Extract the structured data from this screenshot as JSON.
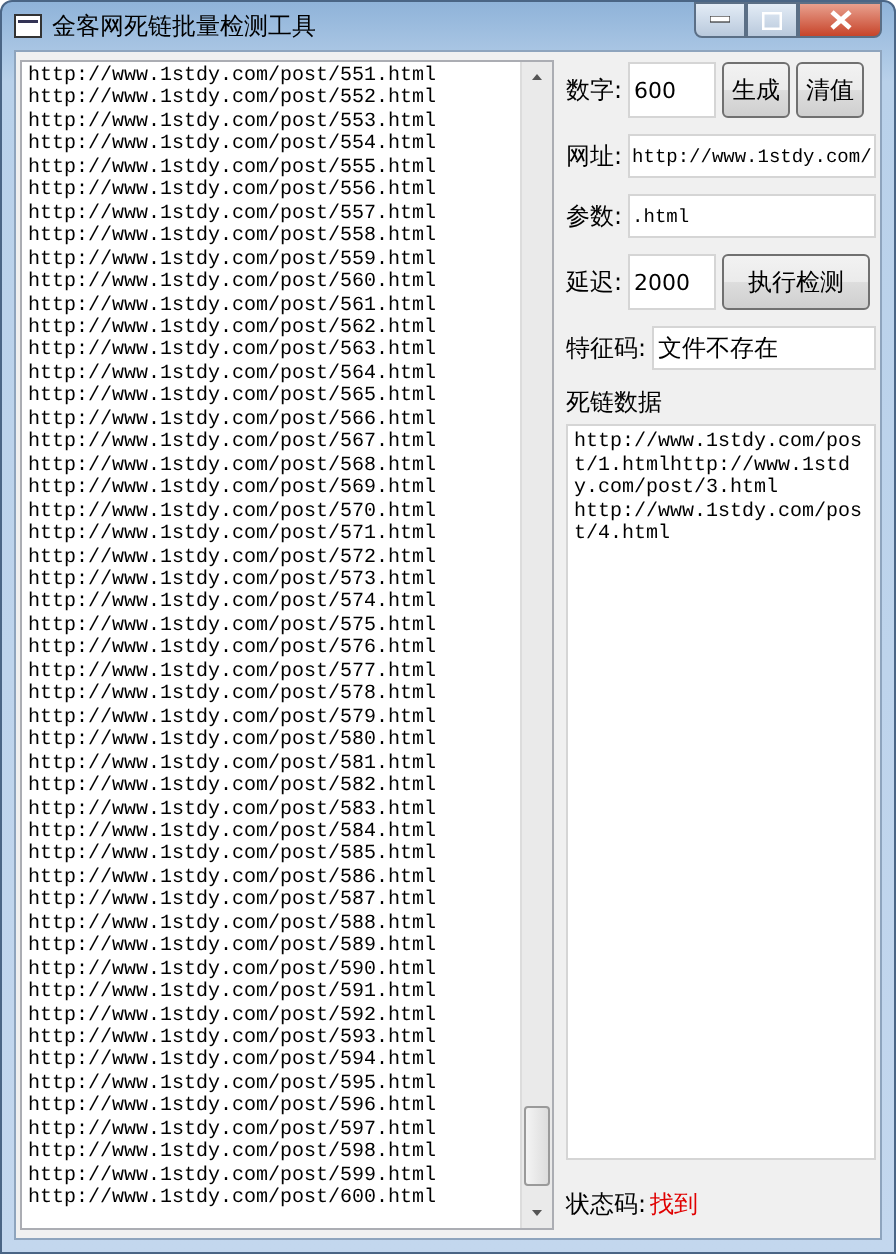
{
  "window": {
    "title": "金客网死链批量检测工具"
  },
  "url_list": [
    "http://www.1stdy.com/post/551.html",
    "http://www.1stdy.com/post/552.html",
    "http://www.1stdy.com/post/553.html",
    "http://www.1stdy.com/post/554.html",
    "http://www.1stdy.com/post/555.html",
    "http://www.1stdy.com/post/556.html",
    "http://www.1stdy.com/post/557.html",
    "http://www.1stdy.com/post/558.html",
    "http://www.1stdy.com/post/559.html",
    "http://www.1stdy.com/post/560.html",
    "http://www.1stdy.com/post/561.html",
    "http://www.1stdy.com/post/562.html",
    "http://www.1stdy.com/post/563.html",
    "http://www.1stdy.com/post/564.html",
    "http://www.1stdy.com/post/565.html",
    "http://www.1stdy.com/post/566.html",
    "http://www.1stdy.com/post/567.html",
    "http://www.1stdy.com/post/568.html",
    "http://www.1stdy.com/post/569.html",
    "http://www.1stdy.com/post/570.html",
    "http://www.1stdy.com/post/571.html",
    "http://www.1stdy.com/post/572.html",
    "http://www.1stdy.com/post/573.html",
    "http://www.1stdy.com/post/574.html",
    "http://www.1stdy.com/post/575.html",
    "http://www.1stdy.com/post/576.html",
    "http://www.1stdy.com/post/577.html",
    "http://www.1stdy.com/post/578.html",
    "http://www.1stdy.com/post/579.html",
    "http://www.1stdy.com/post/580.html",
    "http://www.1stdy.com/post/581.html",
    "http://www.1stdy.com/post/582.html",
    "http://www.1stdy.com/post/583.html",
    "http://www.1stdy.com/post/584.html",
    "http://www.1stdy.com/post/585.html",
    "http://www.1stdy.com/post/586.html",
    "http://www.1stdy.com/post/587.html",
    "http://www.1stdy.com/post/588.html",
    "http://www.1stdy.com/post/589.html",
    "http://www.1stdy.com/post/590.html",
    "http://www.1stdy.com/post/591.html",
    "http://www.1stdy.com/post/592.html",
    "http://www.1stdy.com/post/593.html",
    "http://www.1stdy.com/post/594.html",
    "http://www.1stdy.com/post/595.html",
    "http://www.1stdy.com/post/596.html",
    "http://www.1stdy.com/post/597.html",
    "http://www.1stdy.com/post/598.html",
    "http://www.1stdy.com/post/599.html",
    "http://www.1stdy.com/post/600.html"
  ],
  "number": {
    "label": "数字:",
    "value": "600"
  },
  "buttons": {
    "generate": "生成",
    "clear": "清值",
    "run": "执行检测"
  },
  "url": {
    "label": "网址:",
    "value": "http://www.1stdy.com/"
  },
  "params": {
    "label": "参数:",
    "value": ".html"
  },
  "delay": {
    "label": "延迟:",
    "value": "2000"
  },
  "signature": {
    "label": "特征码:",
    "value": "文件不存在"
  },
  "dead_links": {
    "label": "死链数据",
    "value": "http://www.1stdy.com/post/1.htmlhttp://www.1stdy.com/post/3.html\nhttp://www.1stdy.com/post/4.html"
  },
  "status": {
    "label": "状态码:",
    "value": "找到"
  }
}
